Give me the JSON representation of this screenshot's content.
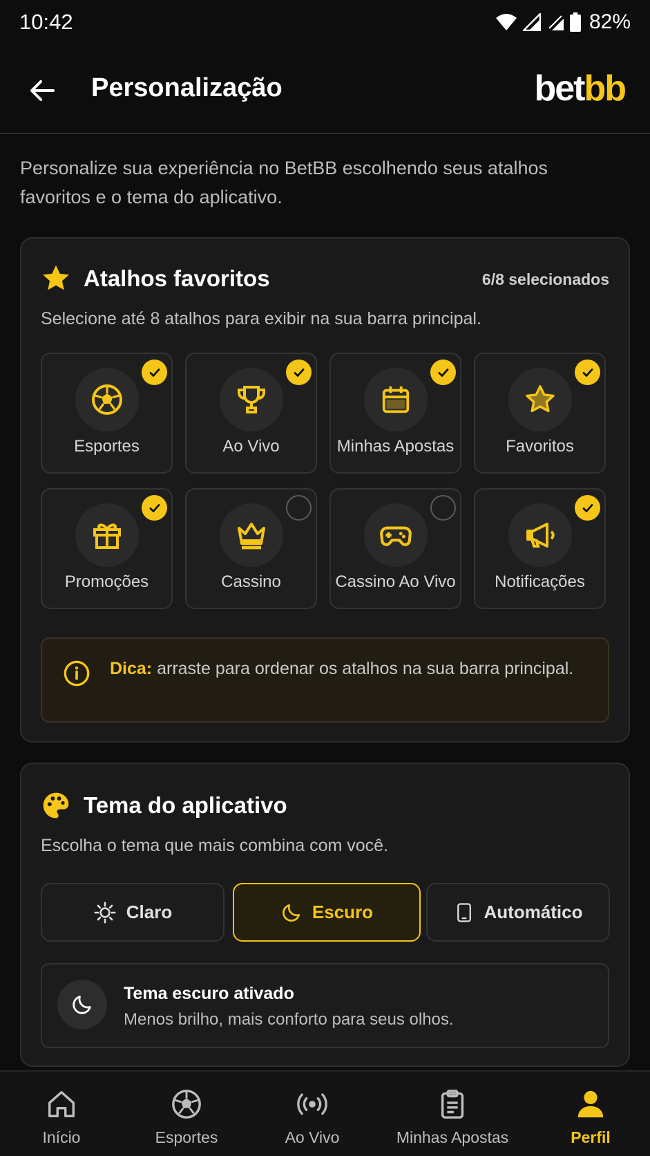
{
  "status_bar": {
    "time": "10:42",
    "battery": "82%"
  },
  "header": {
    "title": "Personalização",
    "brand_part1": "bet",
    "brand_part2": "bb"
  },
  "intro": "Personalize sua experiência no BetBB escolhendo seus atalhos favoritos e o tema do aplicativo.",
  "shortcuts": {
    "title": "Atalhos favoritos",
    "counter": "6/8 selecionados",
    "description": "Selecione até 8 atalhos para exibir na sua barra principal.",
    "items": [
      {
        "label": "Esportes",
        "icon": "soccer-ball-icon",
        "selected": true
      },
      {
        "label": "Ao Vivo",
        "icon": "trophy-icon",
        "selected": true
      },
      {
        "label": "Minhas Apostas",
        "icon": "calendar-icon",
        "selected": true
      },
      {
        "label": "Favoritos",
        "icon": "star-icon",
        "selected": true
      },
      {
        "label": "Promoções",
        "icon": "gift-icon",
        "selected": true
      },
      {
        "label": "Cassino",
        "icon": "crown-icon",
        "selected": false
      },
      {
        "label": "Cassino Ao Vivo",
        "icon": "gamepad-icon",
        "selected": false
      },
      {
        "label": "Notificações",
        "icon": "megaphone-icon",
        "selected": true
      }
    ],
    "tip_label": "Dica:",
    "tip_text": "arraste para ordenar os atalhos na sua barra principal."
  },
  "theme": {
    "title": "Tema do aplicativo",
    "description": "Escolha o tema que mais combina com você.",
    "options": [
      {
        "label": "Claro",
        "icon": "sun-icon",
        "active": false
      },
      {
        "label": "Escuro",
        "icon": "moon-icon",
        "active": true
      },
      {
        "label": "Automático",
        "icon": "phone-icon",
        "active": false
      }
    ],
    "status_title": "Tema escuro ativado",
    "status_subtitle": "Menos brilho, mais conforto para seus olhos."
  },
  "bottom_nav": [
    {
      "label": "Início",
      "icon": "home-icon",
      "active": false
    },
    {
      "label": "Esportes",
      "icon": "soccer-ball-icon",
      "active": false
    },
    {
      "label": "Ao Vivo",
      "icon": "broadcast-icon",
      "active": false
    },
    {
      "label": "Minhas Apostas",
      "icon": "clipboard-icon",
      "active": false
    },
    {
      "label": "Perfil",
      "icon": "user-icon",
      "active": true
    }
  ],
  "colors": {
    "accent": "#f5c518",
    "background": "#0d0d0d",
    "card": "#1a1a1a"
  }
}
